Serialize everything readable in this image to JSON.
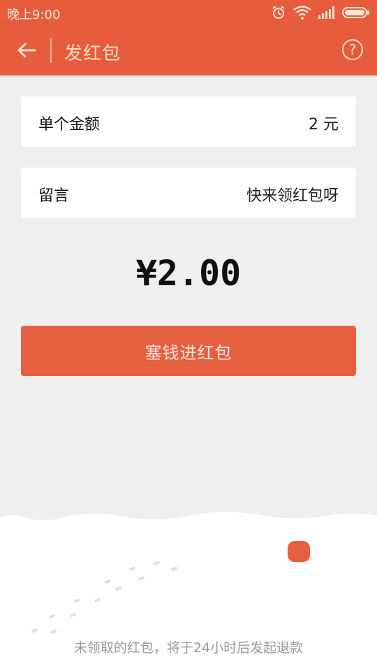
{
  "status_bar": {
    "time": "晚上9:00",
    "icons": [
      "alarm-icon",
      "wifi-icon",
      "signal-icon",
      "battery-icon"
    ]
  },
  "app_bar": {
    "title": "发红包",
    "back_icon": "arrow-left-icon",
    "help_icon": "question-circle-icon",
    "help_symbol": "?"
  },
  "form": {
    "amount_row": {
      "label": "单个金额",
      "value": "2 元"
    },
    "message_row": {
      "label": "留言",
      "value": "快来领红包呀"
    }
  },
  "total_amount": "¥2.00",
  "submit_button": {
    "label": "塞钱进红包"
  },
  "footer_note": "未领取的红包，将于24小时后发起退款",
  "colors": {
    "accent": "#e65c3d",
    "button": "#e6603f",
    "background": "#efefef"
  }
}
